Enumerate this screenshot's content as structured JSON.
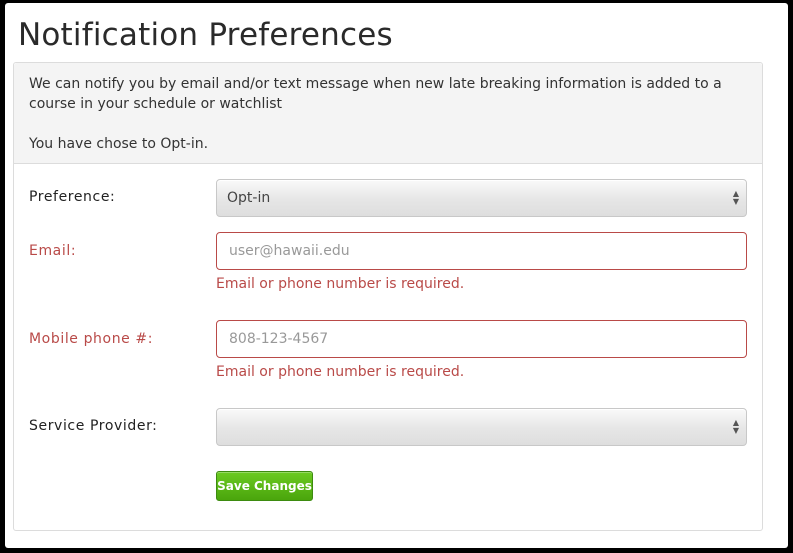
{
  "page": {
    "title": "Notification Preferences"
  },
  "panel": {
    "intro": "We can notify you by email and/or text message when new late breaking information is added to a course in your schedule or watchlist",
    "status": "You have chose to Opt-in."
  },
  "form": {
    "preference": {
      "label": "Preference:",
      "selected": "Opt-in"
    },
    "email": {
      "label": "Email:",
      "value": "",
      "placeholder": "user@hawaii.edu",
      "error": "Email or phone number is required."
    },
    "mobile": {
      "label": "Mobile phone #:",
      "value": "",
      "placeholder": "808-123-4567",
      "error": "Email or phone number is required."
    },
    "provider": {
      "label": "Service Provider:",
      "selected": ""
    },
    "save_label": "Save Changes"
  },
  "colors": {
    "error": "#b94a48",
    "save_button": "#4aa50c"
  },
  "icons": {
    "select_arrows": "up-down-arrows-icon"
  }
}
